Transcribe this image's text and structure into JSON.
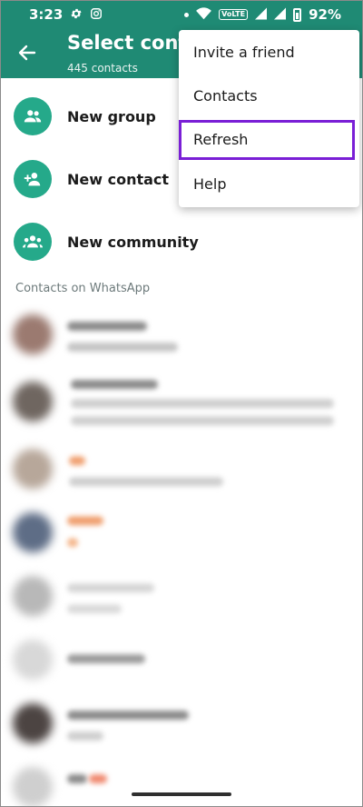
{
  "statusbar": {
    "time": "3:23",
    "left_icons": [
      "gear-icon",
      "instagram-icon"
    ],
    "right_icons": [
      "dot-icon",
      "wifi-icon",
      "volte-icon",
      "signal-icon",
      "signal-icon",
      "battery-icon"
    ],
    "volte_label": "VoLTE",
    "battery": "92%"
  },
  "appbar": {
    "title": "Select contact",
    "subtitle": "445 contacts",
    "background": "#1f8a74"
  },
  "actions": [
    {
      "label": "New group",
      "icon": "group-icon"
    },
    {
      "label": "New contact",
      "icon": "add-person-icon"
    },
    {
      "label": "New community",
      "icon": "community-icon"
    }
  ],
  "section": {
    "header": "Contacts on WhatsApp"
  },
  "menu": {
    "items": [
      "Invite a friend",
      "Contacts",
      "Refresh",
      "Help"
    ],
    "highlighted_item": "Refresh",
    "highlight_color": "#7a1fd6"
  },
  "accent": "#25a98a"
}
